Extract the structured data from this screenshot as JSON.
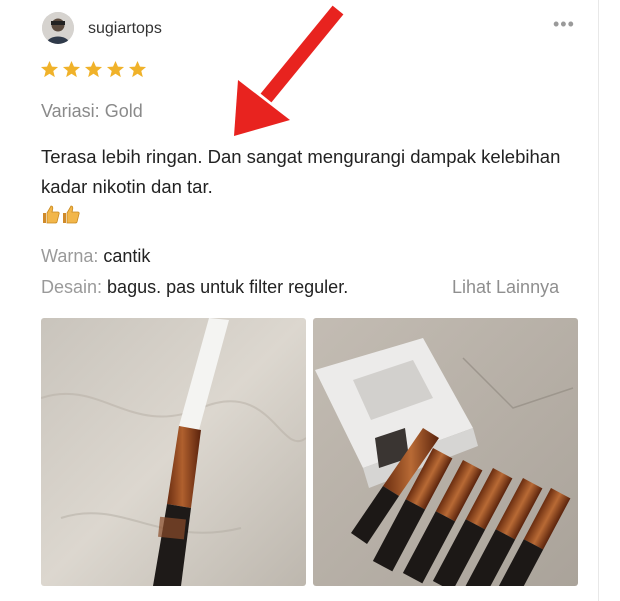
{
  "review": {
    "username": "sugiartops",
    "rating": 5,
    "rating_max": 5,
    "variation_label": "Variasi:",
    "variation_value": "Gold",
    "text": "Terasa lebih ringan. Dan sangat mengurangi dampak kelebihan kadar nikotin dan tar.",
    "emoji": "thumbs-up-icon x2",
    "attributes": [
      {
        "label": "Warna:",
        "value": "cantik"
      },
      {
        "label": "Desain:",
        "value": "bagus. pas untuk filter reguler."
      }
    ],
    "see_more": "Lihat Lainnya",
    "photos": [
      "cigarette-filter-photo",
      "filter-box-photo"
    ]
  },
  "colors": {
    "star": "#f0b22a",
    "arrow": "#e8231f",
    "muted_text": "#8a8a8a",
    "main_text": "#222222"
  }
}
